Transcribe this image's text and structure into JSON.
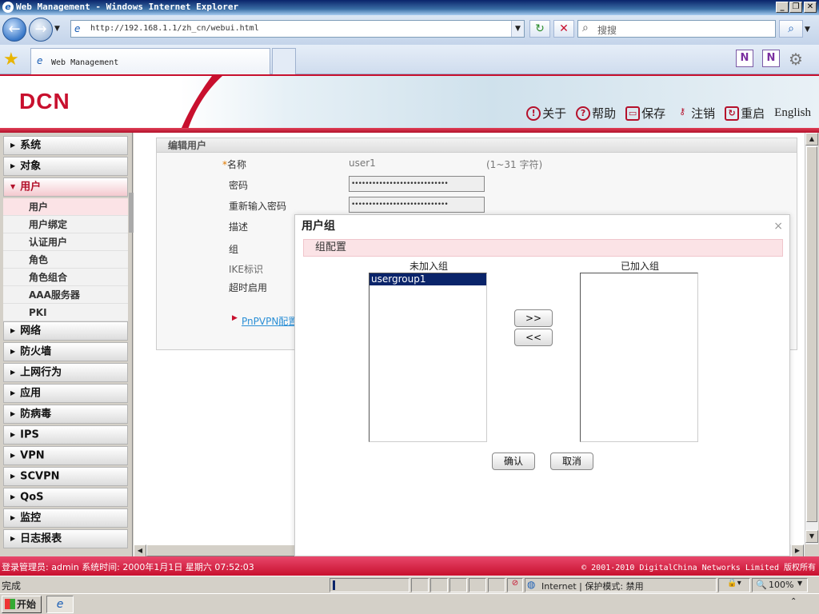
{
  "window": {
    "title": "Web Management - Windows Internet Explorer",
    "minimize": "_",
    "maximize": "❐",
    "close": "✕"
  },
  "browser": {
    "address": "http://192.168.1.1/zh_cn/webui.html",
    "search_placeholder": "搜搜",
    "tab_title": "Web Management"
  },
  "header": {
    "logo": "DCN",
    "nav": [
      {
        "label": "关于",
        "icon": "info-icon",
        "glyph": "!"
      },
      {
        "label": "帮助",
        "icon": "help-icon",
        "glyph": "?"
      },
      {
        "label": "保存",
        "icon": "save-icon",
        "glyph": "▭"
      },
      {
        "label": "注销",
        "icon": "key-icon",
        "glyph": "⚷"
      },
      {
        "label": "重启",
        "icon": "restart-icon",
        "glyph": "↻"
      }
    ],
    "english": "English"
  },
  "sidebar": {
    "items": [
      "系统",
      "对象",
      "用户"
    ],
    "user_sub": [
      "用户",
      "用户绑定",
      "认证用户",
      "角色",
      "角色组合",
      "AAA服务器",
      "PKI"
    ],
    "items_after": [
      "网络",
      "防火墙",
      "上网行为",
      "应用",
      "防病毒",
      "IPS",
      "VPN",
      "SCVPN",
      "QoS",
      "监控",
      "日志报表"
    ]
  },
  "edit_user": {
    "title": "编辑用户",
    "name_label": "名称",
    "name_value": "user1",
    "name_hint": "(1~31 字符)",
    "password_label": "密码",
    "password_value": "••••••••••••••••••••••••••••",
    "repassword_label": "重新输入密码",
    "repassword_value": "••••••••••••••••••••••••••••",
    "desc_label": "描述",
    "group_label": "组",
    "ike_label": "IKE标识",
    "timeout_label": "超时启用",
    "pnp_link": "PnPVPN配置"
  },
  "modal": {
    "title": "用户组",
    "close": "×",
    "section": "组配置",
    "left_header": "未加入组",
    "right_header": "已加入组",
    "left_options": [
      "usergroup1"
    ],
    "add_btn": ">>",
    "remove_btn": "<<",
    "ok": "确认",
    "cancel": "取消"
  },
  "infobar": {
    "login_label": "登录管理员:",
    "login_user": "admin",
    "time_label": "系统时间:",
    "time_value": "2000年1月1日 星期六 07:52:03",
    "copyright": "© 2001-2010 DigitalChina Networks Limited 版权所有"
  },
  "iestatus": {
    "done": "完成",
    "zone": "Internet | 保护模式: 禁用",
    "zoom": "100%"
  },
  "taskbar": {
    "start": "开始"
  }
}
